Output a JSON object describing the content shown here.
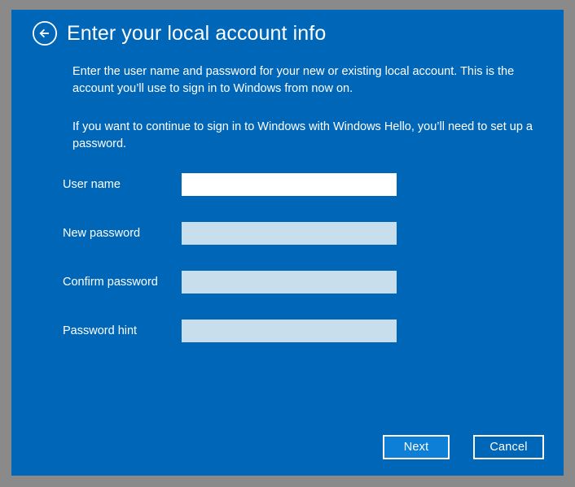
{
  "window": {
    "title": "Enter your local account info",
    "background_color": "#8a8a8a",
    "dialog_color": "#0067b8"
  },
  "header": {
    "back_icon": "back-arrow-circle-icon",
    "title": "Enter your local account info"
  },
  "intro": {
    "paragraph_1": "Enter the user name and password for your new or existing local account. This is the account you’ll use to sign in to Windows from now on.",
    "paragraph_2": "If you want to continue to sign in to Windows with Windows Hello, you’ll need to set up a password."
  },
  "form": {
    "fields": [
      {
        "name": "user-name",
        "label": "User name",
        "value": "",
        "placeholder": "",
        "state": "active",
        "background": "#ffffff"
      },
      {
        "name": "new-password",
        "label": "New password",
        "value": "",
        "placeholder": "",
        "state": "inactive",
        "background": "#c9deec"
      },
      {
        "name": "confirm-password",
        "label": "Confirm password",
        "value": "",
        "placeholder": "",
        "state": "inactive",
        "background": "#c9deec"
      },
      {
        "name": "password-hint",
        "label": "Password hint",
        "value": "",
        "placeholder": "",
        "state": "inactive",
        "background": "#c9deec"
      }
    ]
  },
  "footer": {
    "next_label": "Next",
    "cancel_label": "Cancel",
    "next_fill_color": "#0d7fd7",
    "button_border_color": "#ffffff"
  }
}
